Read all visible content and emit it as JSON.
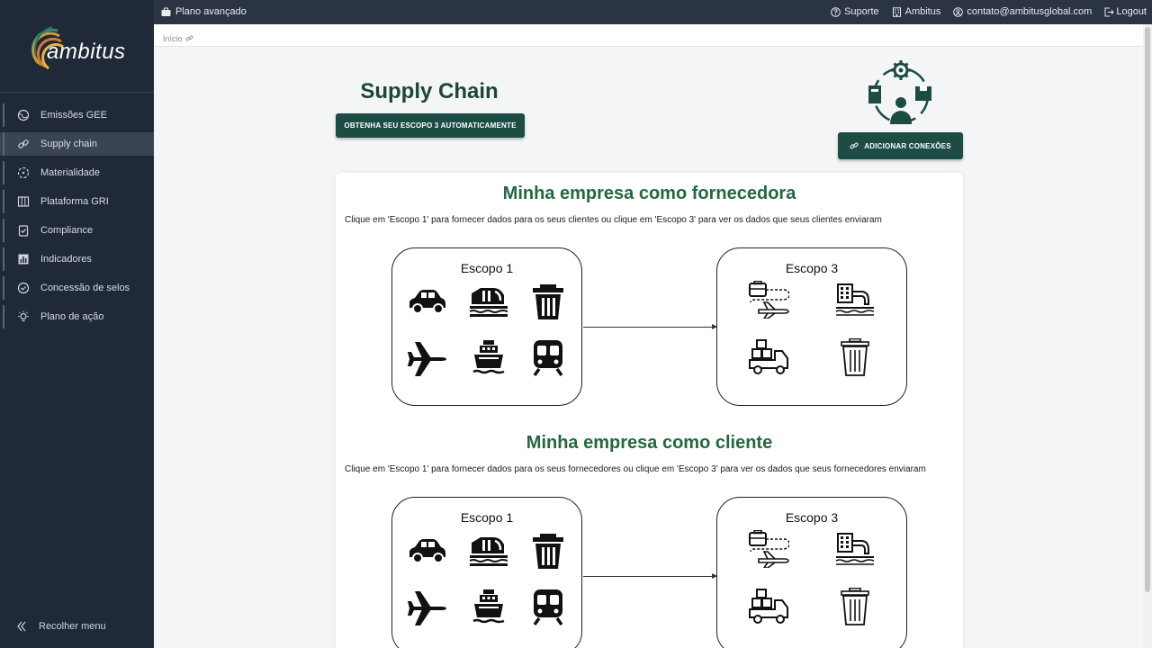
{
  "topbar": {
    "plan": "Plano avançado",
    "support": "Suporte",
    "company": "Ambitus",
    "email": "contato@ambitusglobal.com",
    "logout": "Logout"
  },
  "breadcrumb": {
    "home": "Início"
  },
  "brand": {
    "logo_text": "ambitus"
  },
  "sidebar": {
    "items": [
      {
        "label": "Emissões GEE",
        "icon": "globe-icon"
      },
      {
        "label": "Supply chain",
        "icon": "link-icon"
      },
      {
        "label": "Materialidade",
        "icon": "target-icon"
      },
      {
        "label": "Plataforma GRI",
        "icon": "columns-icon"
      },
      {
        "label": "Compliance",
        "icon": "clipboard-check-icon"
      },
      {
        "label": "Indicadores",
        "icon": "bar-chart-icon"
      },
      {
        "label": "Concessão de selos",
        "icon": "seal-icon"
      },
      {
        "label": "Plano de ação",
        "icon": "lightbulb-icon"
      }
    ],
    "collapse": "Recolher menu"
  },
  "page": {
    "title": "Supply Chain",
    "auto_button": "OBTENHA SEU ESCOPO 3 AUTOMATICAMENTE",
    "add_button": "ADICIONAR CONEXÕES"
  },
  "sections": [
    {
      "title": "Minha empresa como fornecedora",
      "description": "Clique em 'Escopo 1' para fornecer dados para os seus clientes ou clique em 'Escopo 3' para ver os dados que seus clientes enviaram",
      "scope1": "Escopo 1",
      "scope3": "Escopo 3"
    },
    {
      "title": "Minha empresa como cliente",
      "description": "Clique em 'Escopo 1' para fornecer dados para os seus fornecedores ou clique em 'Escopo 3' para ver os dados que seus fornecedores enviaram",
      "scope1": "Escopo 1",
      "scope3": "Escopo 3"
    }
  ],
  "colors": {
    "sidebar_bg": "#1f2937",
    "topbar_bg": "#2b3442",
    "title_green": "#1d4734",
    "section_green": "#23683f",
    "button_bg": "#1d4c44"
  }
}
